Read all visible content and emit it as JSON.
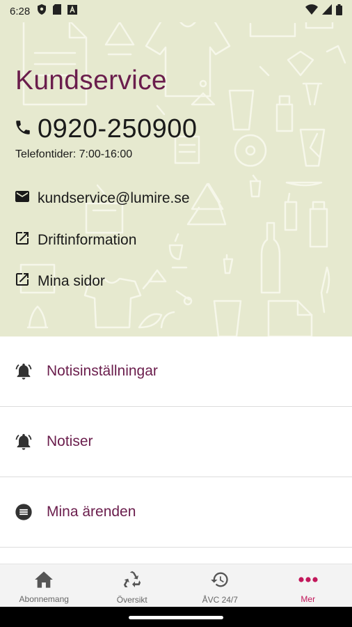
{
  "status_bar": {
    "time": "6:28",
    "left_icons": [
      "shield-icon",
      "sim-card-icon",
      "app-a-icon"
    ],
    "right_icons": [
      "wifi-icon",
      "signal-icon",
      "battery-icon"
    ]
  },
  "kundservice": {
    "title": "Kundservice",
    "phone": "0920-250900",
    "hours": "Telefontider: 7:00-16:00",
    "email": "kundservice@lumire.se",
    "links": [
      {
        "label": "Driftinformation",
        "icon": "external-link-icon"
      },
      {
        "label": "Mina sidor",
        "icon": "external-link-icon"
      }
    ]
  },
  "menu": [
    {
      "label": "Notisinställningar",
      "icon": "bell-icon"
    },
    {
      "label": "Notiser",
      "icon": "bell-icon"
    },
    {
      "label": "Mina ärenden",
      "icon": "list-circle-icon"
    }
  ],
  "bottom_nav": [
    {
      "label": "Abonnemang",
      "icon": "home-icon",
      "active": false
    },
    {
      "label": "Översikt",
      "icon": "recycle-icon",
      "active": false
    },
    {
      "label": "ÅVC 24/7",
      "icon": "history-icon",
      "active": false
    },
    {
      "label": "Mer",
      "icon": "more-dots-icon",
      "active": true
    }
  ],
  "colors": {
    "hero_bg": "#e6e9cf",
    "brand": "#6a1d4c",
    "active_nav": "#c2185b"
  }
}
